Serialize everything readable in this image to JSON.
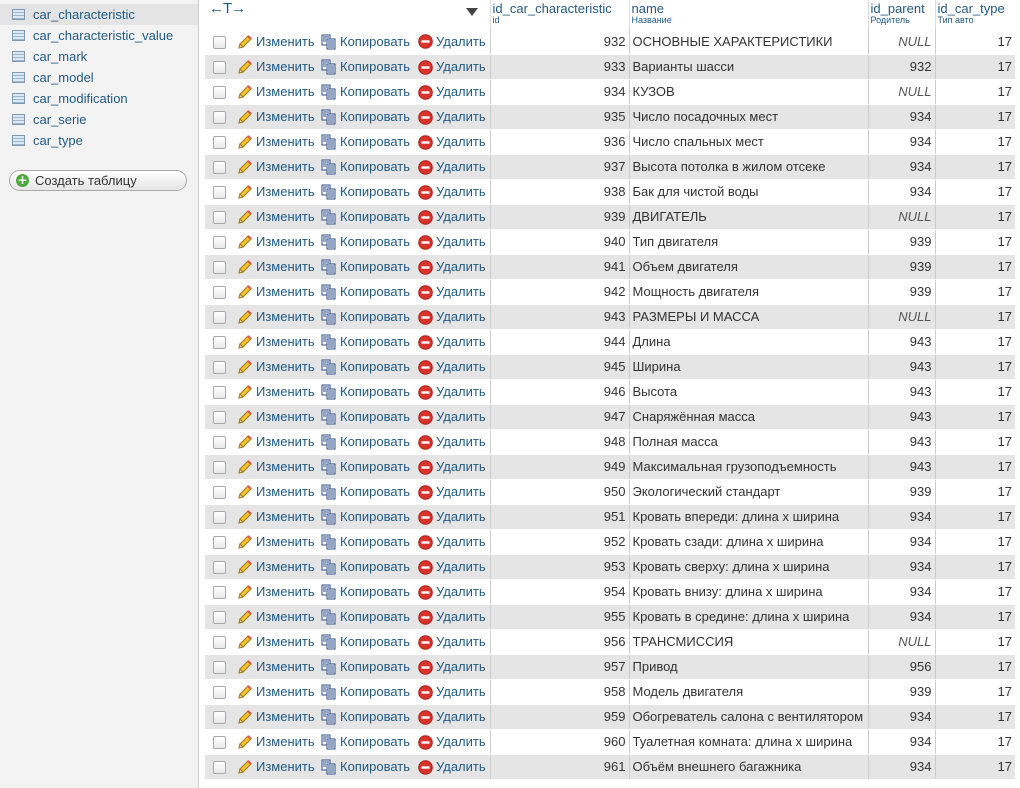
{
  "sidebar": {
    "tables": [
      "car_characteristic",
      "car_characteristic_value",
      "car_mark",
      "car_model",
      "car_modification",
      "car_serie",
      "car_type"
    ],
    "active_index": 0,
    "create_table_label": "Создать таблицу"
  },
  "header": {
    "arrows_label": "←T→",
    "columns": [
      {
        "title": "id_car_characteristic",
        "comment": "id"
      },
      {
        "title": "name",
        "comment": "Название"
      },
      {
        "title": "id_parent",
        "comment": "Родитель"
      },
      {
        "title": "id_car_type",
        "comment": "Тип авто"
      }
    ]
  },
  "actions": {
    "edit": "Изменить",
    "copy": "Копировать",
    "delete": "Удалить"
  },
  "rows": [
    {
      "id": "932",
      "name": "ОСНОВНЫЕ ХАРАКТЕРИСТИКИ",
      "parent": "NULL",
      "type": "17"
    },
    {
      "id": "933",
      "name": "Варианты шасси",
      "parent": "932",
      "type": "17"
    },
    {
      "id": "934",
      "name": "КУЗОВ",
      "parent": "NULL",
      "type": "17"
    },
    {
      "id": "935",
      "name": "Число посадочных мест",
      "parent": "934",
      "type": "17"
    },
    {
      "id": "936",
      "name": "Число спальных мест",
      "parent": "934",
      "type": "17"
    },
    {
      "id": "937",
      "name": "Высота потолка в жилом отсеке",
      "parent": "934",
      "type": "17"
    },
    {
      "id": "938",
      "name": "Бак для чистой воды",
      "parent": "934",
      "type": "17"
    },
    {
      "id": "939",
      "name": "ДВИГАТЕЛЬ",
      "parent": "NULL",
      "type": "17"
    },
    {
      "id": "940",
      "name": "Тип двигателя",
      "parent": "939",
      "type": "17"
    },
    {
      "id": "941",
      "name": "Объем двигателя",
      "parent": "939",
      "type": "17"
    },
    {
      "id": "942",
      "name": "Мощность двигателя",
      "parent": "939",
      "type": "17"
    },
    {
      "id": "943",
      "name": "РАЗМЕРЫ И МАССА",
      "parent": "NULL",
      "type": "17"
    },
    {
      "id": "944",
      "name": "Длина",
      "parent": "943",
      "type": "17"
    },
    {
      "id": "945",
      "name": "Ширина",
      "parent": "943",
      "type": "17"
    },
    {
      "id": "946",
      "name": "Высота",
      "parent": "943",
      "type": "17"
    },
    {
      "id": "947",
      "name": "Снаряжённая масса",
      "parent": "943",
      "type": "17"
    },
    {
      "id": "948",
      "name": "Полная масса",
      "parent": "943",
      "type": "17"
    },
    {
      "id": "949",
      "name": "Максимальная грузоподъемность",
      "parent": "943",
      "type": "17"
    },
    {
      "id": "950",
      "name": "Экологический стандарт",
      "parent": "939",
      "type": "17"
    },
    {
      "id": "951",
      "name": "Кровать впереди: длина х ширина",
      "parent": "934",
      "type": "17"
    },
    {
      "id": "952",
      "name": "Кровать сзади: длина х ширина",
      "parent": "934",
      "type": "17"
    },
    {
      "id": "953",
      "name": "Кровать сверху: длина х ширина",
      "parent": "934",
      "type": "17"
    },
    {
      "id": "954",
      "name": "Кровать внизу: длина х ширина",
      "parent": "934",
      "type": "17"
    },
    {
      "id": "955",
      "name": "Кровать в средине: длина х ширина",
      "parent": "934",
      "type": "17"
    },
    {
      "id": "956",
      "name": "ТРАНСМИССИЯ",
      "parent": "NULL",
      "type": "17"
    },
    {
      "id": "957",
      "name": "Привод",
      "parent": "956",
      "type": "17"
    },
    {
      "id": "958",
      "name": "Модель двигателя",
      "parent": "939",
      "type": "17"
    },
    {
      "id": "959",
      "name": "Обогреватель салона с вентилятором",
      "parent": "934",
      "type": "17"
    },
    {
      "id": "960",
      "name": "Туалетная комната: длина х ширина",
      "parent": "934",
      "type": "17"
    },
    {
      "id": "961",
      "name": "Объём внешнего багажника",
      "parent": "934",
      "type": "17"
    }
  ],
  "colors": {
    "link": "#235a81",
    "row_alt": "#e5e5e5",
    "sidebar_bg": "#f3f3f3"
  }
}
